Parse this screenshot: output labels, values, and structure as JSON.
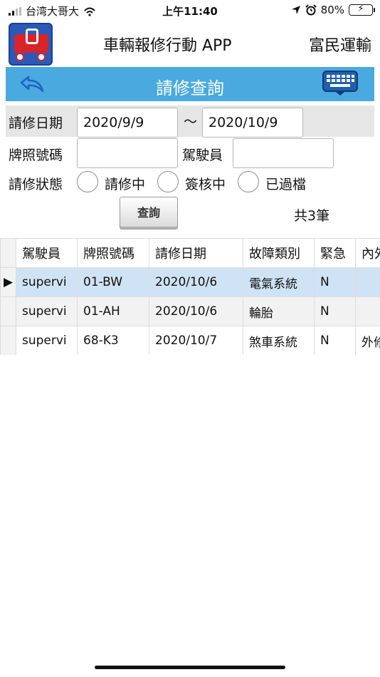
{
  "status_bar": {
    "carrier": "台湾大哥大",
    "time": "上午11:40",
    "battery": "80%",
    "battery_level": 0.8,
    "icons": [
      "signal-icon",
      "wifi-icon",
      "location-icon",
      "alarm-icon",
      "battery-icon"
    ]
  },
  "header": {
    "app_title": "車輛報修行動 APP",
    "company": "富民運輸",
    "logo": "truck-repair-logo"
  },
  "titlebar": {
    "title": "請修查詢",
    "back_icon": "back-arrow-icon",
    "keyboard_icon": "keyboard-icon"
  },
  "form": {
    "date_label": "請修日期",
    "date_from": "2020/9/9",
    "date_sep": "～",
    "date_to": "2020/10/9",
    "plate_label": "牌照號碼",
    "plate_value": "",
    "driver_label": "駕駛員",
    "driver_value": "",
    "status_label": "請修狀態",
    "status_options": [
      "請修中",
      "簽核中",
      "已過檔"
    ],
    "query_button": "查詢",
    "count_text": "共3筆"
  },
  "grid": {
    "columns": [
      "駕駛員",
      "牌照號碼",
      "請修日期",
      "故障類別",
      "緊急",
      "內外"
    ],
    "rows": [
      {
        "indicator": "▶",
        "cells": [
          "supervi",
          "01-BW",
          "2020/10/6",
          "電氣系統",
          "N",
          ""
        ]
      },
      {
        "indicator": "",
        "cells": [
          "supervi",
          "01-AH",
          "2020/10/6",
          "輪胎",
          "N",
          ""
        ]
      },
      {
        "indicator": "",
        "cells": [
          "supervi",
          "68-K3",
          "2020/10/7",
          "煞車系統",
          "N",
          "外修"
        ]
      }
    ]
  },
  "colors": {
    "titlebar": "#4aa9de",
    "selected_row": "#cfe3f5",
    "form_band": "#e6e6e6"
  }
}
